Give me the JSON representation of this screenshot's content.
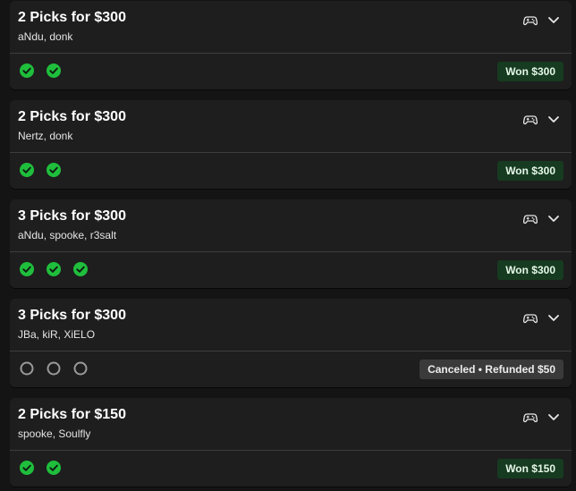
{
  "colors": {
    "background": "#141414",
    "card": "#1e1e1e",
    "won_check": "#1fbe3c",
    "won_badge_bg": "#163b20",
    "pending_ring": "#9a9a9a",
    "canceled_badge_bg": "#3a3a3a"
  },
  "entries": [
    {
      "title": "2 Picks for $300",
      "players": "aNdu, donk",
      "game_icon": "gamepad-icon",
      "expand_icon": "chevron-down-icon",
      "picks": [
        "won",
        "won"
      ],
      "status_type": "won",
      "status_label": "Won $300"
    },
    {
      "title": "2 Picks for $300",
      "players": "Nertz, donk",
      "game_icon": "gamepad-icon",
      "expand_icon": "chevron-down-icon",
      "picks": [
        "won",
        "won"
      ],
      "status_type": "won",
      "status_label": "Won $300"
    },
    {
      "title": "3 Picks for $300",
      "players": "aNdu, spooke, r3salt",
      "game_icon": "gamepad-icon",
      "expand_icon": "chevron-down-icon",
      "picks": [
        "won",
        "won",
        "won"
      ],
      "status_type": "won",
      "status_label": "Won $300"
    },
    {
      "title": "3 Picks for $300",
      "players": "JBa, kiR, XiELO",
      "game_icon": "gamepad-icon",
      "expand_icon": "chevron-down-icon",
      "picks": [
        "pending",
        "pending",
        "pending"
      ],
      "status_type": "canceled",
      "status_label": "Canceled • Refunded $50"
    },
    {
      "title": "2 Picks for $150",
      "players": "spooke, Soulfly",
      "game_icon": "gamepad-icon",
      "expand_icon": "chevron-down-icon",
      "picks": [
        "won",
        "won"
      ],
      "status_type": "won",
      "status_label": "Won $150"
    }
  ]
}
